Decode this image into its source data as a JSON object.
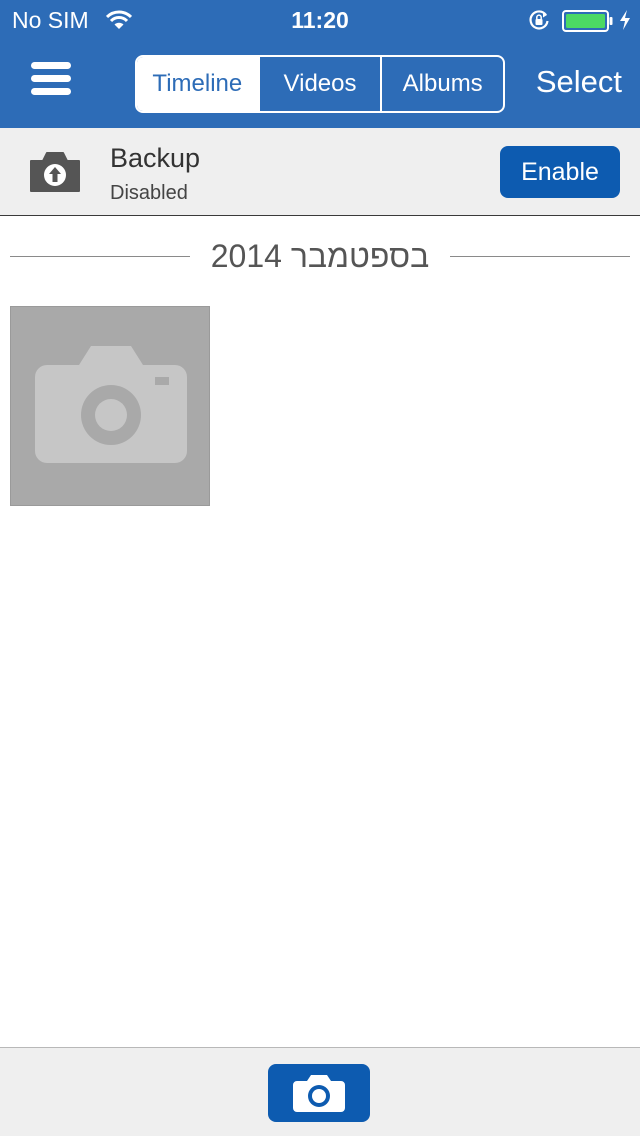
{
  "status_bar": {
    "carrier": "No SIM",
    "time": "11:20",
    "icons": [
      "wifi-icon",
      "rotation-lock-icon",
      "battery-icon",
      "charging-icon"
    ],
    "battery_color": "#4cd964"
  },
  "nav": {
    "menu_icon": "hamburger-menu-icon",
    "tabs": [
      {
        "label": "Timeline",
        "selected": true
      },
      {
        "label": "Videos",
        "selected": false
      },
      {
        "label": "Albums",
        "selected": false
      }
    ],
    "select_label": "Select"
  },
  "backup": {
    "icon": "camera-upload-icon",
    "title": "Backup",
    "status": "Disabled",
    "enable_label": "Enable"
  },
  "timeline": {
    "section_title": "בספטמבר 2014",
    "photos": [
      {
        "type": "placeholder",
        "icon": "camera-placeholder-icon"
      }
    ]
  },
  "bottom_bar": {
    "camera_icon": "camera-icon"
  },
  "colors": {
    "brand_blue": "#2d6cb7",
    "button_blue": "#0d5bb0",
    "banner_gray": "#efefef",
    "tile_gray": "#a9a9a9"
  }
}
